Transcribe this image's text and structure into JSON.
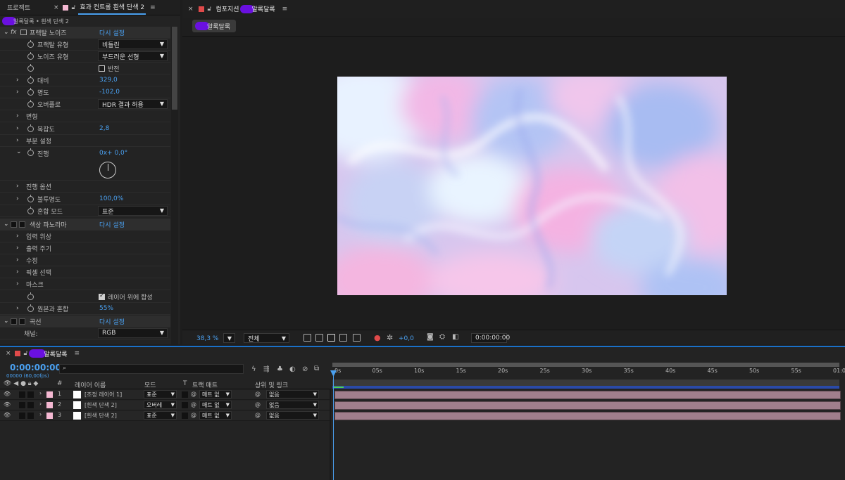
{
  "effects_panel": {
    "tab_project": "프로젝트",
    "tab_effects": "효과 컨트롤 흰색 단색 2",
    "breadcrumb": "알록달록 • 흰색 단색 2",
    "fractal": {
      "name": "프랙탈 노이즈",
      "reset": "다시 설정",
      "fractal_type_label": "프랙탈 유형",
      "fractal_type_value": "비틀린",
      "noise_type_label": "노이즈 유형",
      "noise_type_value": "부드러운 선형",
      "invert_label": "반전",
      "contrast_label": "대비",
      "contrast_value": "329,0",
      "brightness_label": "명도",
      "brightness_value": "-102,0",
      "overflow_label": "오버플로",
      "overflow_value": "HDR 결과 허용",
      "transform_label": "변형",
      "complexity_label": "복잡도",
      "complexity_value": "2,8",
      "sub_label": "부분 설정",
      "evolution_label": "진행",
      "evolution_value": "0x+ 0,0°",
      "evolution_options_label": "진행 옵션",
      "opacity_label": "불투명도",
      "opacity_value": "100,0%",
      "blend_label": "혼합 모드",
      "blend_value": "표준"
    },
    "colorama": {
      "name": "색상 파노라마",
      "reset": "다시 설정",
      "input_phase": "입력 위상",
      "output_cycle": "출력 주기",
      "modify": "수정",
      "pixel_select": "픽셀 선택",
      "mask": "마스크",
      "composite_label": "레이어 위에 합성",
      "blend_original_label": "원본과 혼합",
      "blend_original_value": "55%"
    },
    "curves": {
      "name": "곡선",
      "reset": "다시 설정",
      "channel_label": "채널:",
      "channel_value": "RGB"
    }
  },
  "composition": {
    "title": "컴포지션",
    "comp_name": "알록달록",
    "chip_label": "알록달록",
    "zoom": "38,3 %",
    "resolution": "전체",
    "exposure": "+0,0",
    "timecode": "0:00:00:00"
  },
  "timeline": {
    "comp_name": "알록달록",
    "timecode": "0:00:00:00",
    "fps": "00000 (60,00fps)",
    "columns": {
      "num": "#",
      "layer_name": "레이어 이름",
      "mode": "모드",
      "t": "T",
      "track_matte": "트랙 매트",
      "parent": "상위 및 링크"
    },
    "ruler_ticks": [
      "0s",
      "05s",
      "10s",
      "15s",
      "20s",
      "25s",
      "30s",
      "35s",
      "40s",
      "45s",
      "50s",
      "55s",
      "01:0"
    ],
    "layers": [
      {
        "num": "1",
        "name": "[조정 레이어 1]",
        "mode": "표준",
        "matte": "매트 없",
        "parent": "없음",
        "label_color": "#f4b8d2"
      },
      {
        "num": "2",
        "name": "[흰색 단색 2]",
        "mode": "오버레",
        "matte": "매트 없",
        "parent": "없음",
        "label_color": "#f4b8d2"
      },
      {
        "num": "3",
        "name": "[흰색 단색 2]",
        "mode": "표준",
        "matte": "매트 없",
        "parent": "없음",
        "label_color": "#f4b8d2"
      }
    ]
  },
  "colors": {
    "accent_blue": "#4aa0f0",
    "highlight_purple": "#6a10e0",
    "layer_bar": "#a07f8c"
  }
}
